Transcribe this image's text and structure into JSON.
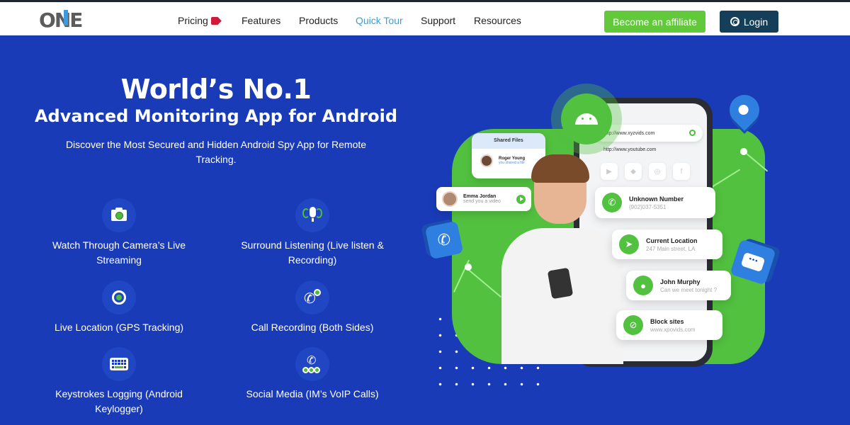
{
  "header": {
    "logo_text": "ONE",
    "nav": [
      {
        "label": "Pricing",
        "icon": "price-tag-icon",
        "active": false
      },
      {
        "label": "Features",
        "active": false
      },
      {
        "label": "Products",
        "active": false
      },
      {
        "label": "Quick Tour",
        "active": true
      },
      {
        "label": "Support",
        "active": false
      },
      {
        "label": "Resources",
        "active": false
      }
    ],
    "affiliate_button": "Become an affiliate",
    "login_button": "Login",
    "login_icon": "fingerprint-icon"
  },
  "hero": {
    "title": "World’s No.1",
    "subtitle": "Advanced Monitoring App for Android",
    "description": "Discover the Most Secured and Hidden Android Spy App for Remote Tracking.",
    "features": [
      {
        "icon": "camera-icon",
        "label": "Watch Through Camera’s Live Streaming"
      },
      {
        "icon": "microphone-icon",
        "label": "Surround Listening (Live listen & Recording)"
      },
      {
        "icon": "gps-target-icon",
        "label": "Live Location (GPS Tracking)"
      },
      {
        "icon": "call-recording-icon",
        "label": "Call Recording (Both Sides)"
      },
      {
        "icon": "keyboard-icon",
        "label": "Keystrokes Logging (Android Keylogger)"
      },
      {
        "icon": "voip-call-icon",
        "label": "Social Media (IM’s VoIP Calls)"
      }
    ]
  },
  "illustration": {
    "shared_files": {
      "title": "Shared Files",
      "name": "Roger Young",
      "subtitle": "you shared a file"
    },
    "message": {
      "name": "Emma Jordan",
      "text": "send you a video"
    },
    "browser": {
      "url1": "http://www.xyzvids.com",
      "url2": "http://www.youtube.com"
    },
    "cards": [
      {
        "icon": "phone-icon",
        "title": "Unknown Number",
        "subtitle": "(902)037-5351"
      },
      {
        "icon": "navigation-icon",
        "title": "Current Location",
        "subtitle": "247 Main street, LA"
      },
      {
        "icon": "chat-icon",
        "title": "John Murphy",
        "subtitle": "Can we meet tonight ?"
      },
      {
        "icon": "block-icon",
        "title": "Block sites",
        "subtitle": "www.xpovids.com"
      }
    ]
  },
  "colors": {
    "hero_bg": "#1a3bb8",
    "accent_green": "#52c13f",
    "affiliate_btn": "#62c93b",
    "login_btn": "#153e59",
    "nav_active": "#3aa0d8",
    "pricing_tag": "#d11a3a"
  }
}
